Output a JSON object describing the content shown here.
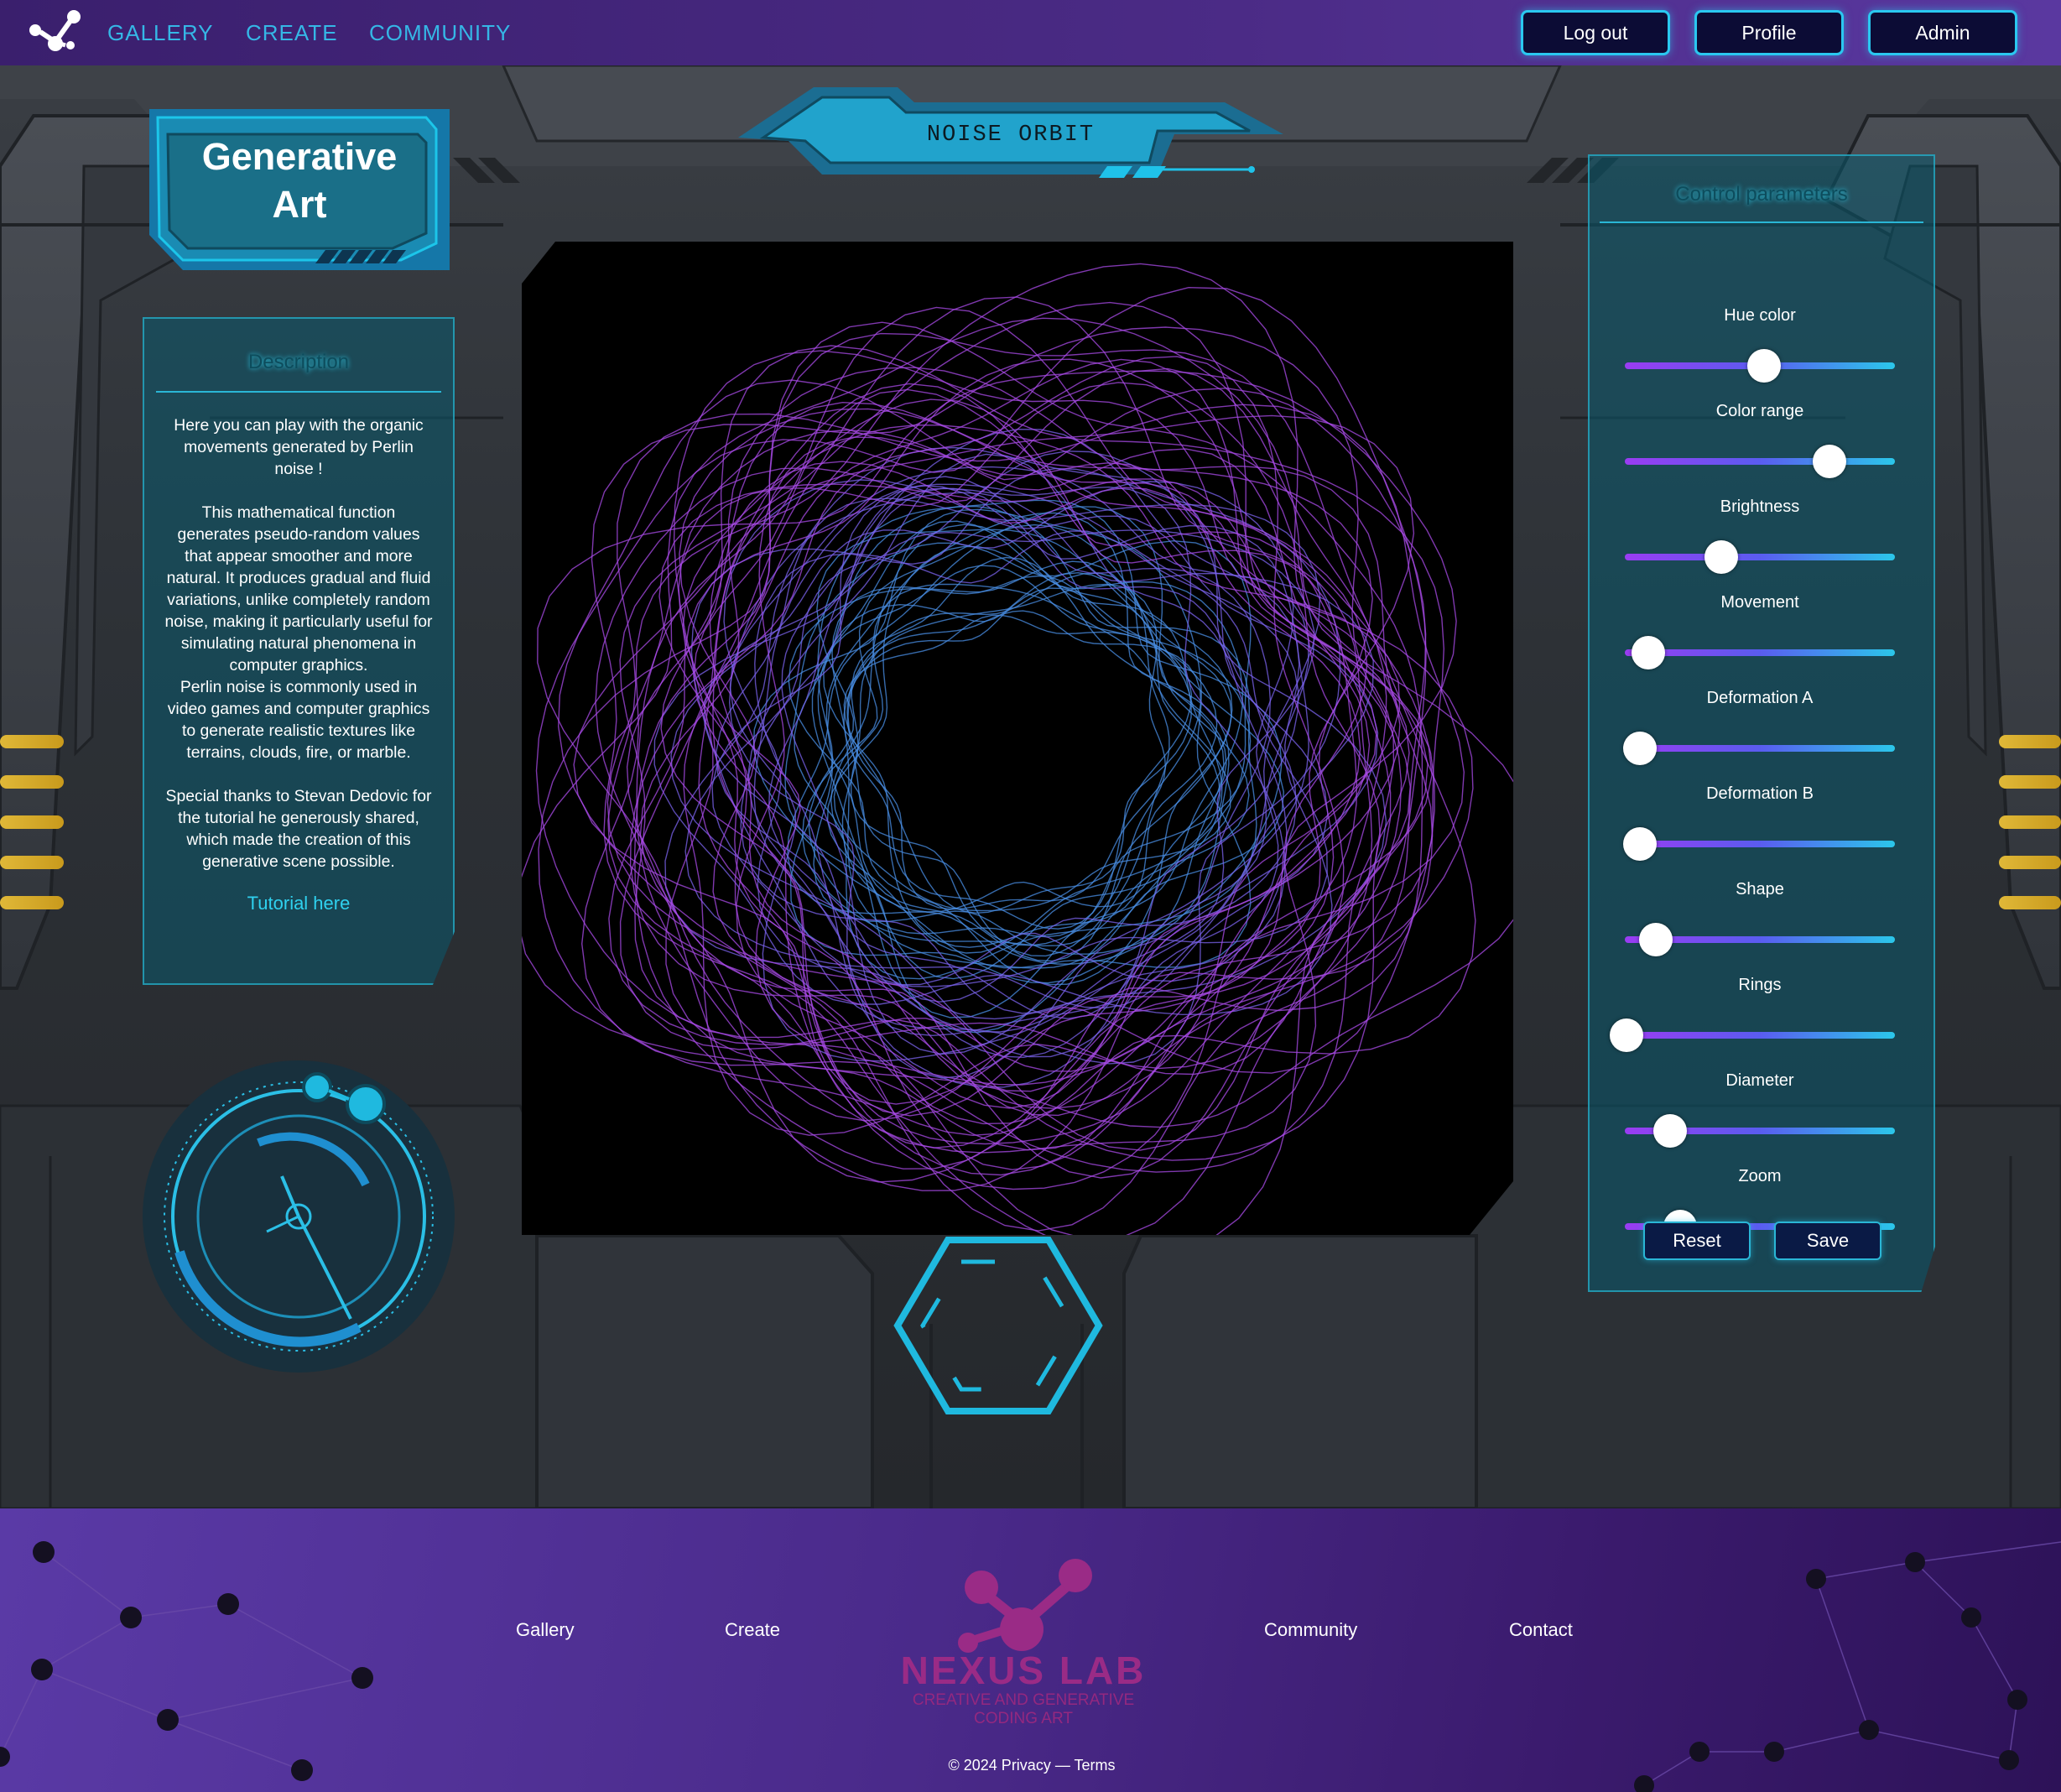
{
  "nav": {
    "links": [
      "GALLERY",
      "CREATE",
      "COMMUNITY"
    ],
    "buttons": [
      "Log out",
      "Profile",
      "Admin"
    ]
  },
  "hero": {
    "title_line1": "Generative",
    "title_line2": "Art",
    "artwork_title": "NOISE ORBIT"
  },
  "description": {
    "heading": "Description",
    "body": "Here you can play with the organic movements generated by Perlin noise !\n\nThis mathematical function generates pseudo-random values that appear smoother and more natural. It produces gradual and fluid variations, unlike completely random noise, making it particularly useful for simulating natural phenomena in computer graphics.\nPerlin noise is commonly used in video games and computer graphics to generate realistic textures like terrains, clouds, fire, or marble.\n\nSpecial thanks to Stevan Dedovic for the tutorial he generously shared, which made the creation of this generative scene possible.",
    "tutorial_link": "Tutorial here"
  },
  "controls": {
    "heading": "Control parameters",
    "sliders": [
      {
        "label": "Hue color",
        "value": 0.51
      },
      {
        "label": "Color range",
        "value": 0.75
      },
      {
        "label": "Brightness",
        "value": 0.35
      },
      {
        "label": "Movement",
        "value": 0.08
      },
      {
        "label": "Deformation A",
        "value": 0.05
      },
      {
        "label": "Deformation B",
        "value": 0.05
      },
      {
        "label": "Shape",
        "value": 0.11
      },
      {
        "label": "Rings",
        "value": 0.0
      },
      {
        "label": "Diameter",
        "value": 0.16
      },
      {
        "label": "Zoom",
        "value": 0.2
      }
    ],
    "reset_label": "Reset",
    "save_label": "Save"
  },
  "footer": {
    "links": [
      "Gallery",
      "Create",
      "Community",
      "Contact"
    ],
    "brand_name": "NEXUS LAB",
    "brand_tagline_line1": "CREATIVE AND GENERATIVE",
    "brand_tagline_line2": "CODING ART",
    "copyright": "© 2024 Privacy — Terms"
  },
  "colors": {
    "accent": "#2bc7ea",
    "nav_bg": "#4b2b86",
    "footer_bg": "#4a2a8a",
    "art_purple": "#a94be8",
    "art_blue": "#4a8fe6"
  }
}
